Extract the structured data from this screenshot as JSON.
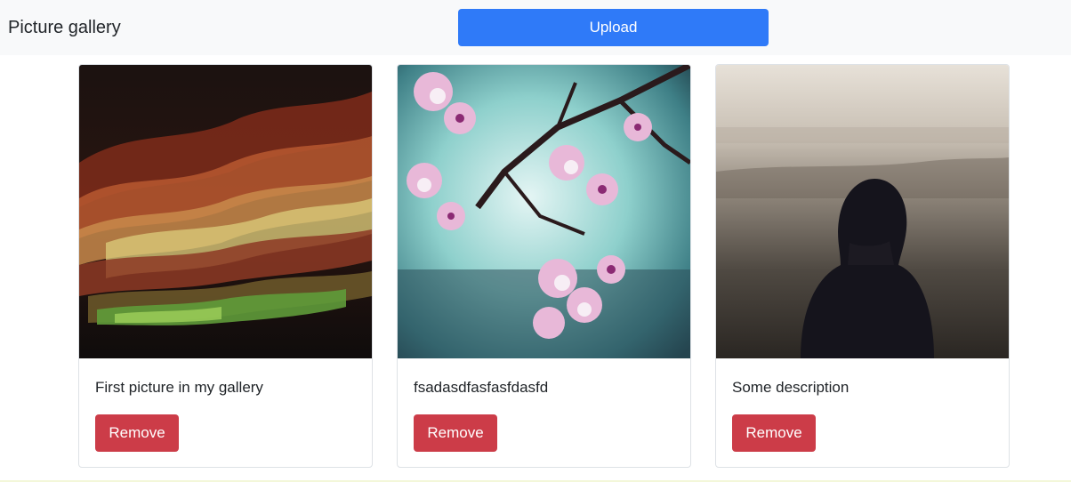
{
  "navbar": {
    "brand": "Picture gallery",
    "upload_label": "Upload"
  },
  "gallery": {
    "cards": [
      {
        "description": "First picture in my gallery",
        "remove_label": "Remove",
        "image": "abstract-layered-autumn-leaves-photo"
      },
      {
        "description": "fsadasdfasfasfdasfd",
        "remove_label": "Remove",
        "image": "pink-blossom-branch-photo"
      },
      {
        "description": "Some description",
        "remove_label": "Remove",
        "image": "person-silhouette-hazy-landscape-photo"
      }
    ]
  },
  "colors": {
    "primary": "#2f7af8",
    "danger": "#cc3c48",
    "navbar_bg": "#f8f9fa"
  }
}
